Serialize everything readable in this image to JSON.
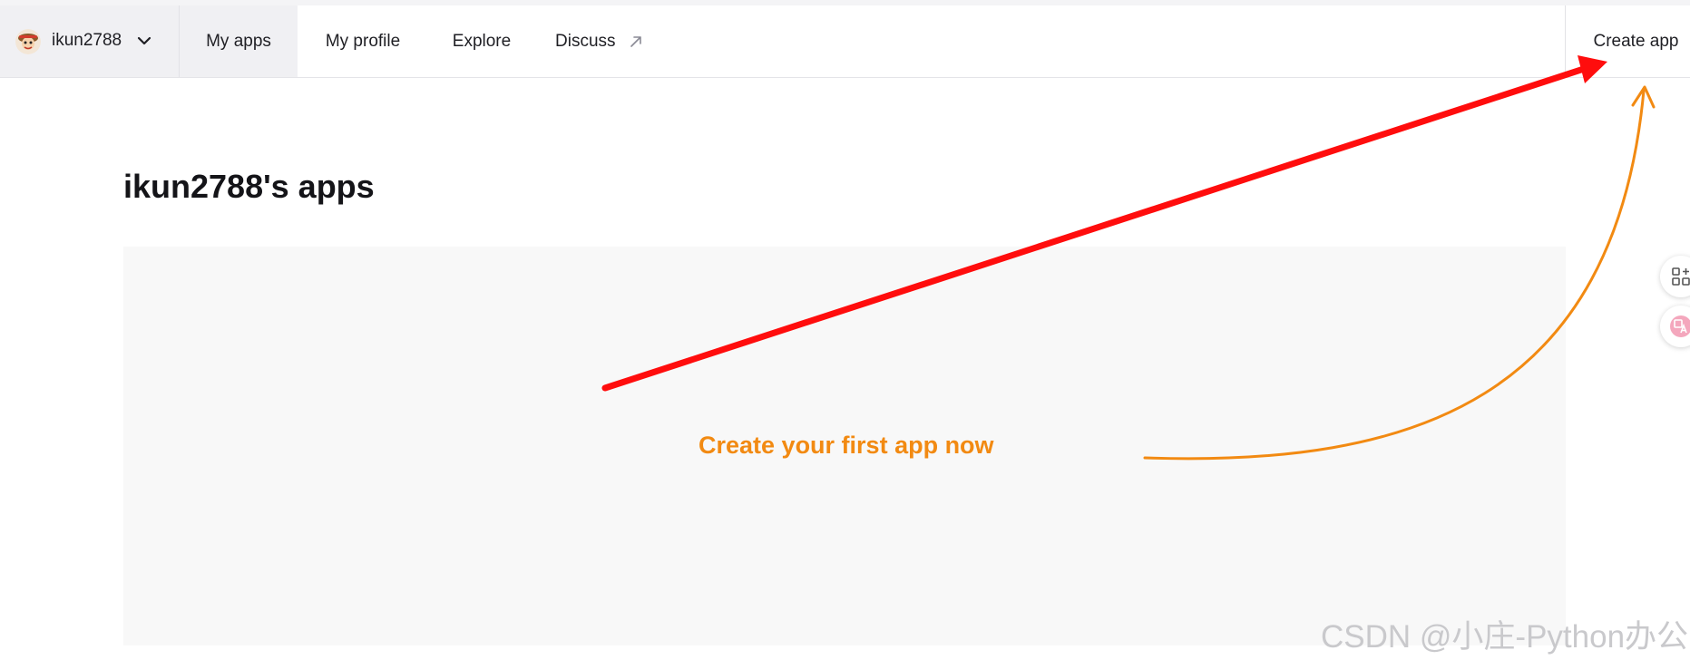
{
  "nav": {
    "username": "ikun2788",
    "tabs": [
      {
        "label": "My apps",
        "active": true
      },
      {
        "label": "My profile",
        "active": false
      },
      {
        "label": "Explore",
        "active": false
      },
      {
        "label": "Discuss",
        "active": false,
        "external": true
      }
    ],
    "create_app_label": "Create app",
    "icons": {
      "avatar": "avatar-image",
      "chevron": "chevron-down-icon",
      "external": "external-link-icon"
    }
  },
  "main": {
    "title": "ikun2788's apps",
    "empty_cta": "Create your first app now"
  },
  "annotations": {
    "red_arrow_color": "#ff0d0d",
    "orange_arrow_color": "#f28a12"
  },
  "side_buttons": [
    {
      "name": "apps-grid-icon"
    },
    {
      "name": "translate-icon"
    }
  ],
  "watermark": "CSDN @小庄-Python办公"
}
